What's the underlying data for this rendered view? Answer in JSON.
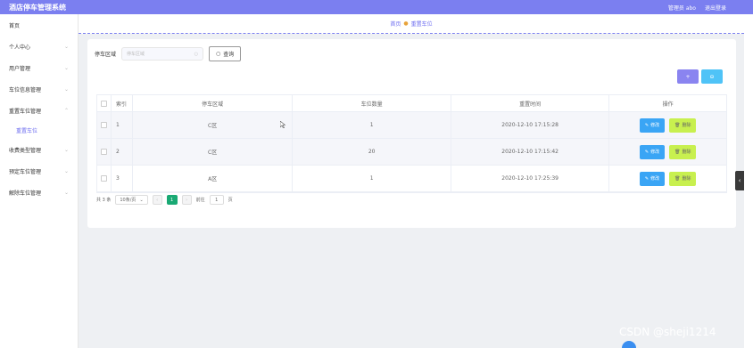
{
  "app": {
    "title": "酒店停车管理系统"
  },
  "topbar": {
    "user_label": "管理员 abo",
    "logout": "退出登录"
  },
  "sidebar": {
    "items": [
      {
        "label": "首页",
        "has_arrow": false
      },
      {
        "label": "个人中心",
        "has_arrow": true
      },
      {
        "label": "用户管理",
        "has_arrow": true
      },
      {
        "label": "车位信息管理",
        "has_arrow": true
      },
      {
        "label": "重置车位管理",
        "has_arrow": true
      },
      {
        "label": "收费类型管理",
        "has_arrow": true
      },
      {
        "label": "预定车位管理",
        "has_arrow": true
      },
      {
        "label": "解除车位管理",
        "has_arrow": true
      }
    ],
    "sub_active": "重置车位"
  },
  "breadcrumb": {
    "home": "首页",
    "current": "重置车位"
  },
  "search": {
    "label": "停车区域",
    "placeholder": "停车区域",
    "button": "查询"
  },
  "actions": {
    "add": "+",
    "delete": "⊖"
  },
  "table": {
    "headers": [
      "索引",
      "停车区域",
      "车位数量",
      "重置时间",
      "操作"
    ],
    "rows": [
      {
        "idx": "1",
        "area": "C区",
        "count": "1",
        "time": "2020-12-10 17:15:28"
      },
      {
        "idx": "2",
        "area": "C区",
        "count": "20",
        "time": "2020-12-10 17:15:42"
      },
      {
        "idx": "3",
        "area": "A区",
        "count": "1",
        "time": "2020-12-10 17:25:39"
      }
    ],
    "edit_label": "修改",
    "delete_label": "删除"
  },
  "pager": {
    "total": "共 3 条",
    "page_size": "10条/页",
    "current_page": "1",
    "goto_label": "前往",
    "goto_value": "1",
    "page_unit": "页"
  },
  "watermark": "CSDN @sheji1214",
  "colors": {
    "primary": "#7b7ff0",
    "accent_green": "#19a974",
    "edit": "#3aa5f5",
    "delete": "#c8f04f"
  }
}
